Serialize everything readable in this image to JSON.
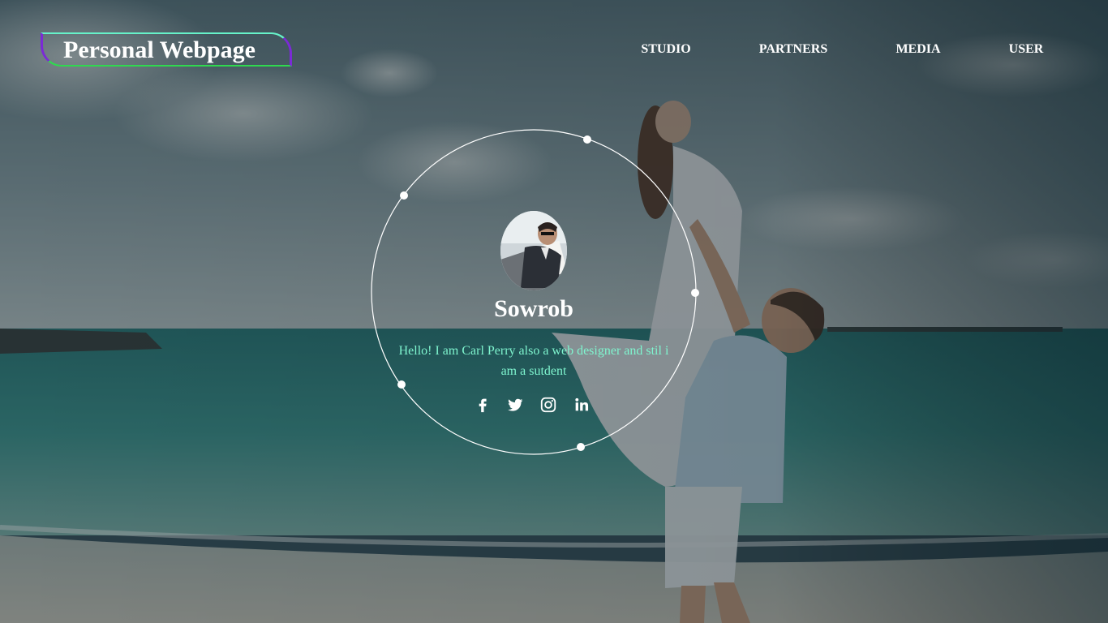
{
  "logo": {
    "text": "Personal Webpage"
  },
  "nav": {
    "items": [
      {
        "label": "STUDIO"
      },
      {
        "label": "PARTNERS"
      },
      {
        "label": "MEDIA"
      },
      {
        "label": "USER"
      }
    ]
  },
  "profile": {
    "name": "Sowrob",
    "bio": "Hello! I am Carl Perry also a web designer and stil i am a sutdent"
  },
  "social": [
    {
      "icon": "facebook-icon"
    },
    {
      "icon": "twitter-icon"
    },
    {
      "icon": "instagram-icon"
    },
    {
      "icon": "linkedin-icon"
    }
  ],
  "colors": {
    "bio_text": "#7ff5cf",
    "logo_border_top": "#66f2c9",
    "logo_border_bottom": "#2fd94f",
    "logo_border_sides": "#7b2ad6",
    "text": "#ffffff"
  }
}
